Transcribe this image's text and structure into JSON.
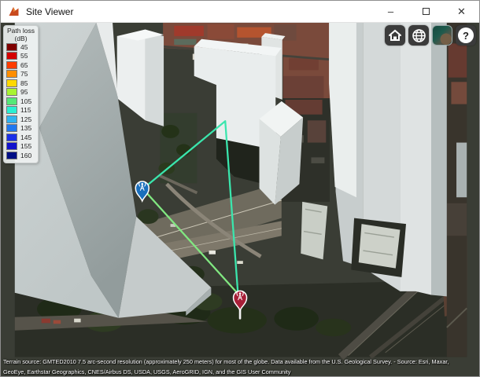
{
  "window": {
    "title": "Site Viewer",
    "controls": {
      "minimize": "–",
      "close": "✕"
    }
  },
  "legend": {
    "title_line1": "Path loss",
    "title_line2": "(dB)",
    "items": [
      {
        "label": "45",
        "color": "#7f0000"
      },
      {
        "label": "55",
        "color": "#d40000"
      },
      {
        "label": "65",
        "color": "#ff3c00"
      },
      {
        "label": "75",
        "color": "#ff8e00"
      },
      {
        "label": "85",
        "color": "#ffd900"
      },
      {
        "label": "95",
        "color": "#a8f432"
      },
      {
        "label": "105",
        "color": "#55e878"
      },
      {
        "label": "115",
        "color": "#2af0d2"
      },
      {
        "label": "125",
        "color": "#2fb4f0"
      },
      {
        "label": "135",
        "color": "#1f78f0"
      },
      {
        "label": "145",
        "color": "#1a30e8"
      },
      {
        "label": "155",
        "color": "#1212cc"
      },
      {
        "label": "160",
        "color": "#000f85"
      }
    ]
  },
  "toolbar": {
    "buttons": [
      {
        "icon": "home"
      },
      {
        "icon": "globe"
      },
      {
        "icon": "basemap-picker"
      },
      {
        "icon": "help",
        "glyph": "?"
      }
    ]
  },
  "map": {
    "markers": [
      {
        "kind": "transmitter-site",
        "pin_color": "#1a6fbc"
      },
      {
        "kind": "receiver-site",
        "pin_color": "#a81f38"
      }
    ],
    "rays": [
      {
        "kind": "reflected-ray",
        "color": "#3ae6ad"
      },
      {
        "kind": "direct-ray",
        "color": "#81e881"
      }
    ],
    "attribution_line1": "Terrain source: GMTED2010 7.5 arc-second resolution (approximately 250 meters) for most of the globe. Data available from the U.S. Geological Survey. - Source: Esri, Maxar,",
    "attribution_line2": "GeoEye, Earthstar Geographics, CNES/Airbus DS, USDA, USGS, AeroGRID, IGN, and the GIS User Community"
  }
}
